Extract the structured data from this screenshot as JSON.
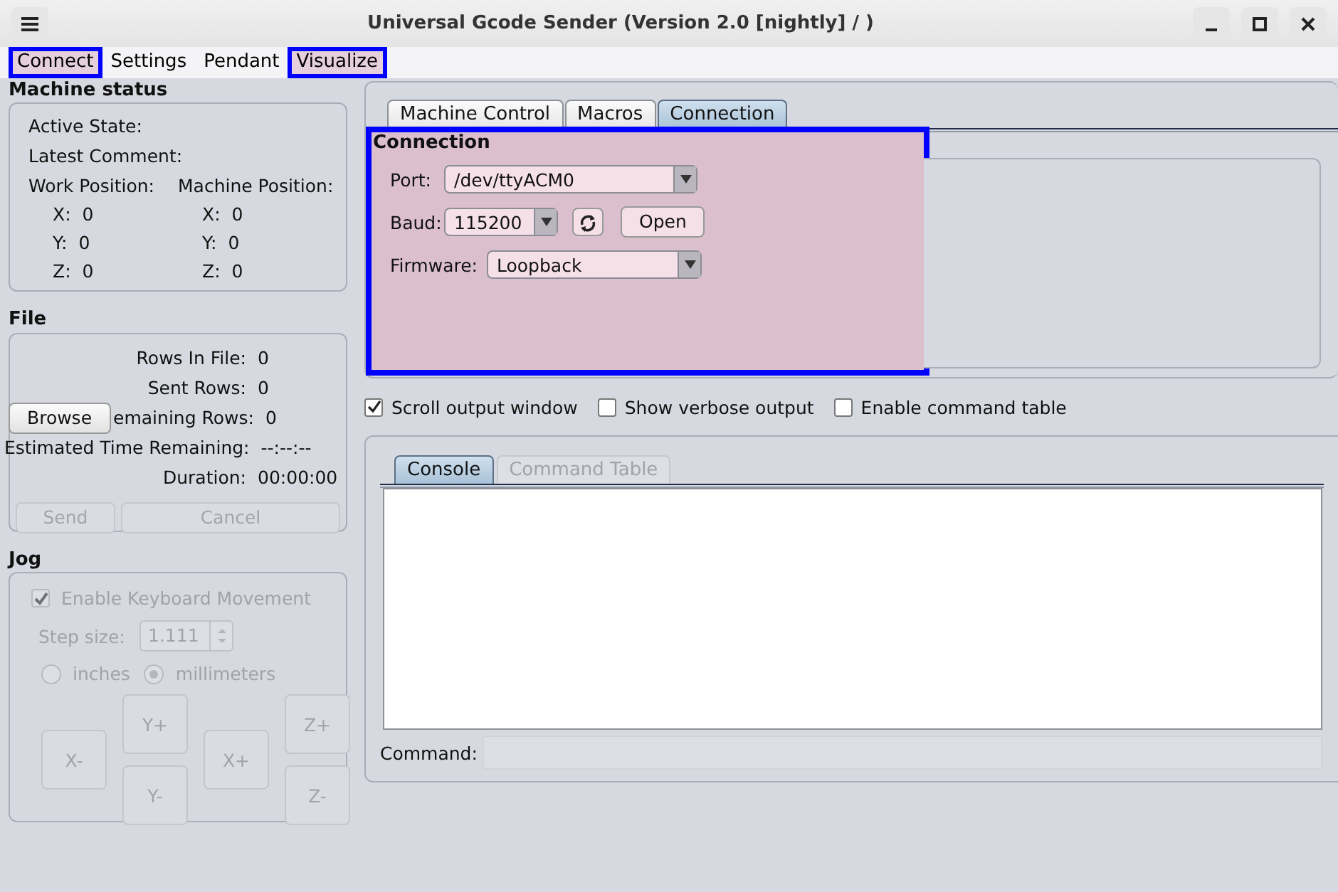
{
  "window": {
    "title": "Universal Gcode Sender (Version 2.0 [nightly] / )"
  },
  "menu": [
    {
      "label": "Connect",
      "highlighted": true
    },
    {
      "label": "Settings",
      "highlighted": false
    },
    {
      "label": "Pendant",
      "highlighted": false
    },
    {
      "label": "Visualize",
      "highlighted": true
    }
  ],
  "machine_status": {
    "title": "Machine status",
    "active_state_label": "Active State:",
    "latest_comment_label": "Latest Comment:",
    "positions": [
      {
        "title": "Work Position:",
        "axes": [
          {
            "axis": "X:",
            "value": "0"
          },
          {
            "axis": "Y:",
            "value": "0"
          },
          {
            "axis": "Z:",
            "value": "0"
          }
        ]
      },
      {
        "title": "Machine Position:",
        "axes": [
          {
            "axis": "X:",
            "value": "0"
          },
          {
            "axis": "Y:",
            "value": "0"
          },
          {
            "axis": "Z:",
            "value": "0"
          }
        ]
      }
    ]
  },
  "file": {
    "title": "File",
    "browse_button": "Browse",
    "stats": [
      {
        "label": "Rows In File:",
        "value": "0"
      },
      {
        "label": "Sent Rows:",
        "value": "0"
      },
      {
        "label": "emaining Rows:",
        "value": "0"
      },
      {
        "label": "Estimated Time Remaining:",
        "value": "--:--:--"
      },
      {
        "label": "Duration:",
        "value": "00:00:00"
      }
    ],
    "buttons": [
      {
        "label": "Send",
        "disabled": true
      },
      {
        "label": "Cancel",
        "disabled": true
      }
    ]
  },
  "jog": {
    "title": "Jog",
    "disabled": true,
    "keyboard": {
      "label": "Enable Keyboard Movement",
      "checked": true
    },
    "step_label": "Step size:",
    "step_value": "1.111",
    "units": [
      {
        "label": "inches",
        "selected": false
      },
      {
        "label": "millimeters",
        "selected": true
      }
    ],
    "buttons": [
      "X-",
      "Y+",
      "Y-",
      "X+",
      "Z+",
      "Z-"
    ]
  },
  "top_tabs": [
    {
      "label": "Machine Control",
      "selected": false
    },
    {
      "label": "Macros",
      "selected": false
    },
    {
      "label": "Connection",
      "selected": true
    }
  ],
  "connection": {
    "title": "Connection",
    "highlighted": true,
    "port_label": "Port:",
    "port": "/dev/ttyACM0",
    "baud_label": "Baud:",
    "baud": "115200",
    "open_button": "Open",
    "firmware_label": "Firmware:",
    "firmware": "Loopback"
  },
  "options": [
    {
      "label": "Scroll output window",
      "checked": true
    },
    {
      "label": "Show verbose output",
      "checked": false
    },
    {
      "label": "Enable command table",
      "checked": false
    }
  ],
  "console_tabs": [
    {
      "label": "Console",
      "selected": true,
      "disabled": false
    },
    {
      "label": "Command Table",
      "selected": false,
      "disabled": true
    }
  ],
  "command_label": "Command:"
}
